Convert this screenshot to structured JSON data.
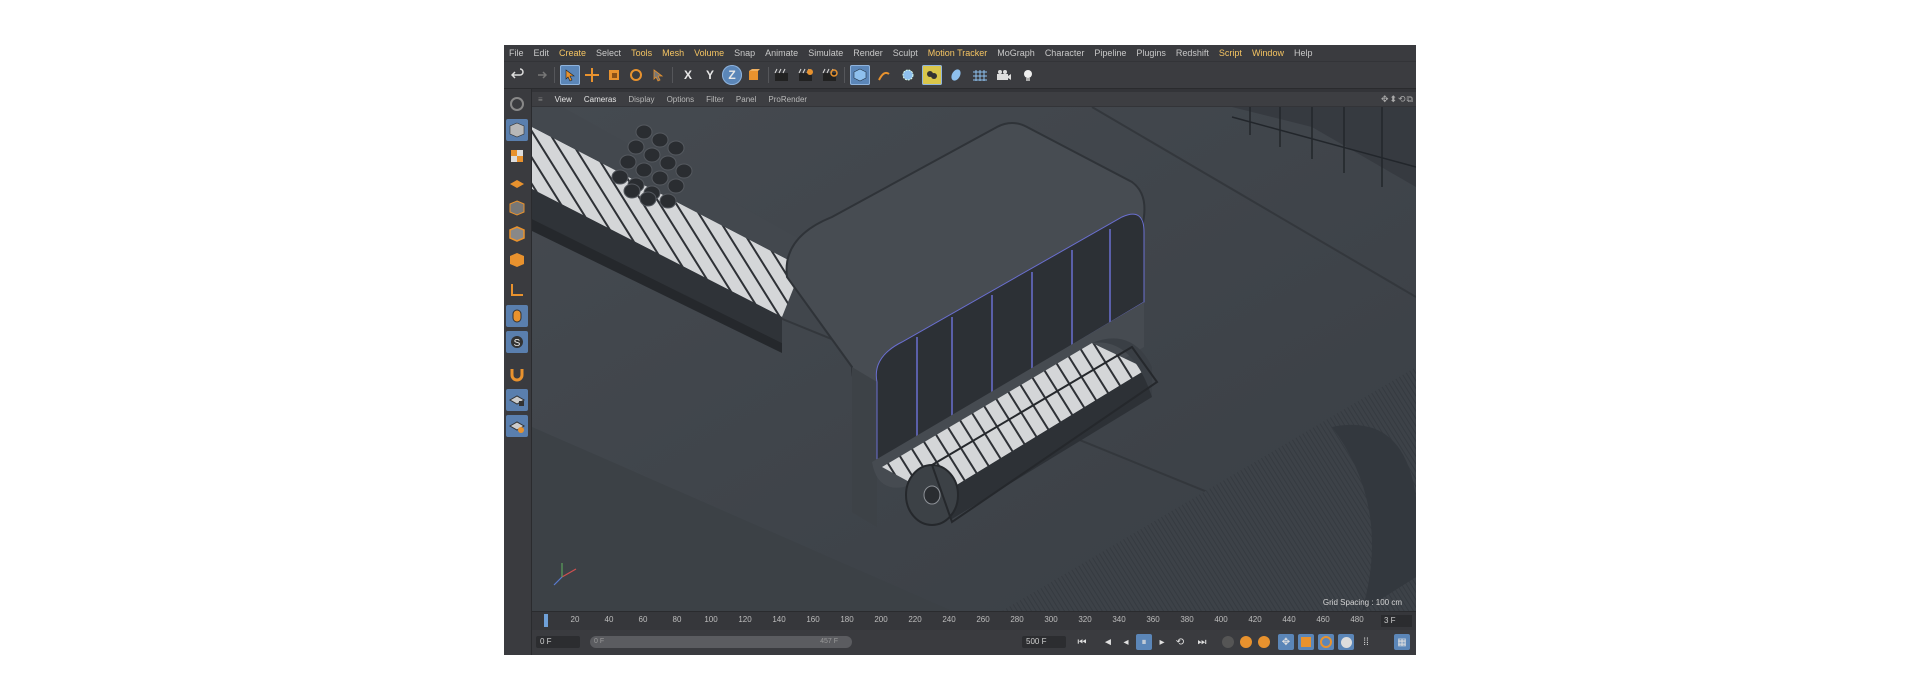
{
  "menu": [
    "File",
    "Edit",
    "Create",
    "Select",
    "Tools",
    "Mesh",
    "Volume",
    "Snap",
    "Animate",
    "Simulate",
    "Render",
    "Sculpt",
    "Motion Tracker",
    "MoGraph",
    "Character",
    "Pipeline",
    "Plugins",
    "Redshift",
    "Script",
    "Window",
    "Help"
  ],
  "menu_highlight": [
    "Create",
    "Tools",
    "Mesh",
    "Volume",
    "Motion Tracker",
    "Script",
    "Window"
  ],
  "toolbar": {
    "axis_x": "X",
    "axis_y": "Y",
    "axis_z": "Z"
  },
  "viewport_menu": [
    "View",
    "Cameras",
    "Display",
    "Options",
    "Filter",
    "Panel",
    "ProRender"
  ],
  "viewport": {
    "grid_spacing": "Grid Spacing : 100 cm"
  },
  "timeline": {
    "ticks": [
      "20",
      "40",
      "60",
      "80",
      "100",
      "120",
      "140",
      "160",
      "180",
      "200",
      "220",
      "240",
      "260",
      "280",
      "300",
      "320",
      "340",
      "360",
      "380",
      "400",
      "420",
      "440",
      "460",
      "480"
    ],
    "current_frame": "3 F"
  },
  "transport": {
    "start_field": "0 F",
    "range_start": "0 F",
    "range_end": "457 F",
    "end_field": "500 F"
  },
  "colors": {
    "accent": "#f5c462",
    "selection": "#5b86b8",
    "orange_icon": "#e8922e"
  }
}
